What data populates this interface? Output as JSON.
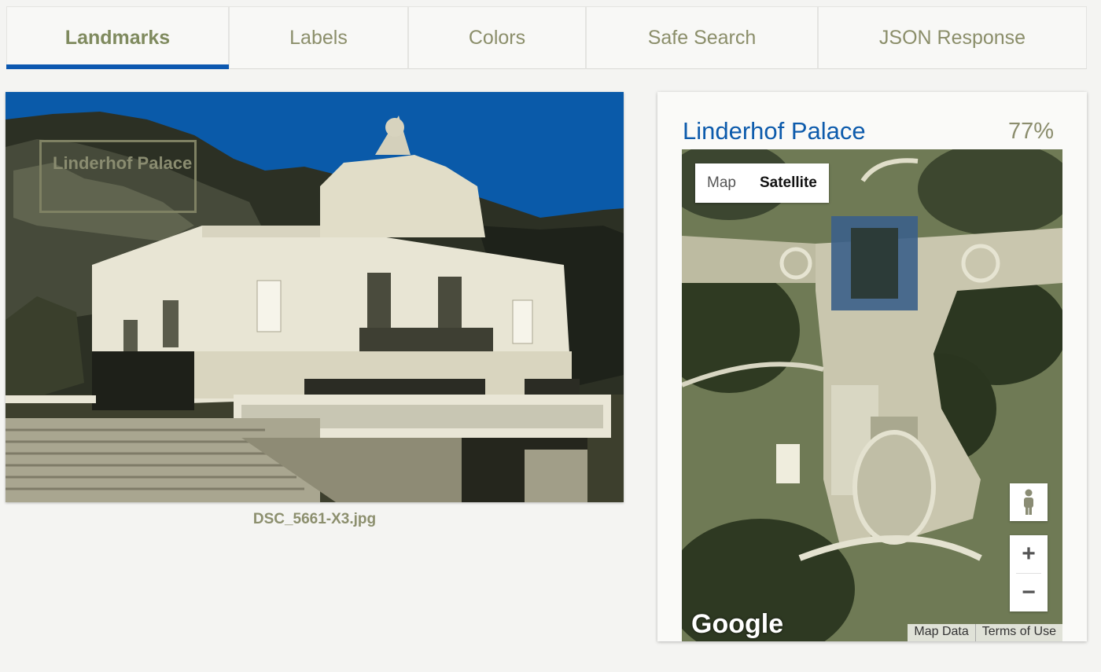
{
  "tabs": [
    {
      "label": "Landmarks",
      "active": true
    },
    {
      "label": "Labels",
      "active": false
    },
    {
      "label": "Colors",
      "active": false
    },
    {
      "label": "Safe Search",
      "active": false
    },
    {
      "label": "JSON Response",
      "active": false
    }
  ],
  "image": {
    "filename": "DSC_5661-X3.jpg",
    "landmark_box_label": "Linderhof Palace"
  },
  "landmark": {
    "name": "Linderhof Palace",
    "score": "77%"
  },
  "map": {
    "type_map": "Map",
    "type_satellite": "Satellite",
    "zoom_in": "+",
    "zoom_out": "−",
    "logo": "Google",
    "map_data": "Map Data",
    "terms": "Terms of Use"
  },
  "colors": {
    "accent": "#0c58b0",
    "tab_text": "#8b8e6a",
    "title": "#0d5bac"
  }
}
